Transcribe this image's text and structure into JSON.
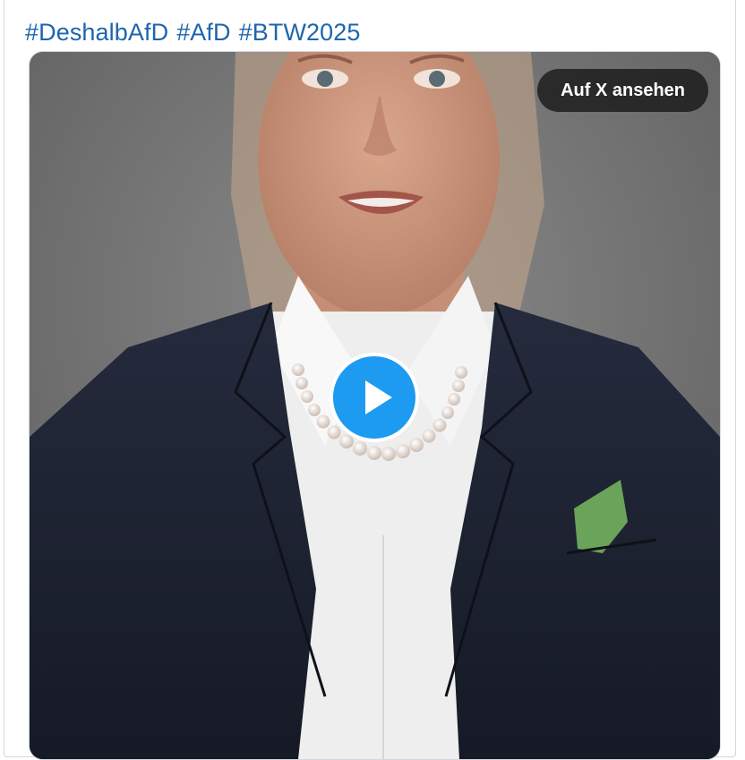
{
  "tweet": {
    "hashtags": [
      "#DeshalbAfD",
      "#AfD",
      "#BTW2025"
    ]
  },
  "media": {
    "view_on_x_label": "Auf X ansehen",
    "play_icon": "play-icon",
    "accent_color": "#1d9bf0",
    "hashtag_color": "#1d65ae"
  }
}
